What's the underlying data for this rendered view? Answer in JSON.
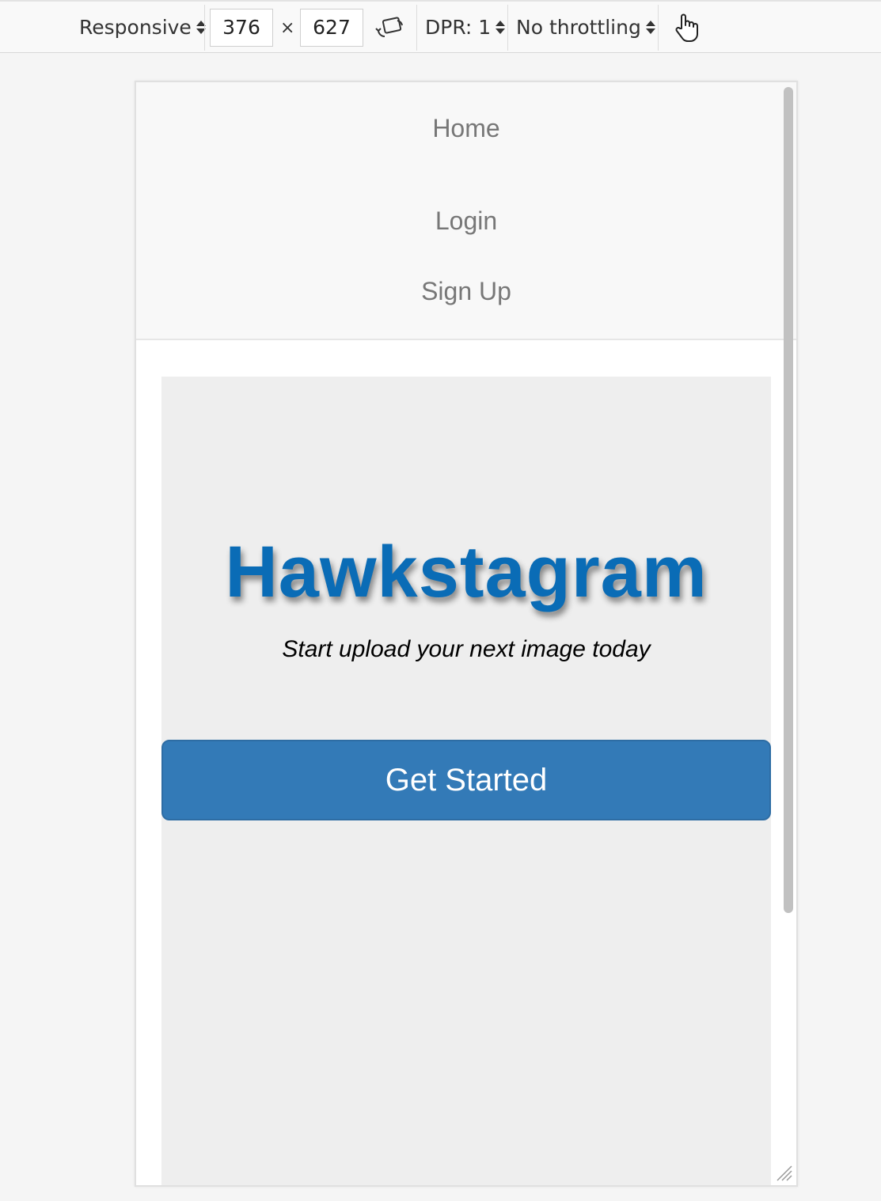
{
  "toolbar": {
    "device_label": "Responsive",
    "width_value": "376",
    "times_symbol": "×",
    "height_value": "627",
    "dpr_label": "DPR: 1",
    "throttling_label": "No throttling"
  },
  "nav": {
    "home": "Home",
    "login": "Login",
    "signup": "Sign Up"
  },
  "hero": {
    "title": "Hawkstagram",
    "tagline": "Start upload your next image today",
    "button_label": "Get Started"
  },
  "colors": {
    "brand": "#0a6cb6",
    "button": "#337ab7",
    "jumbotron_bg": "#eeeeee"
  },
  "icons": [
    "rotate-device-icon",
    "touch-pointer-icon",
    "resize-grip-icon"
  ]
}
